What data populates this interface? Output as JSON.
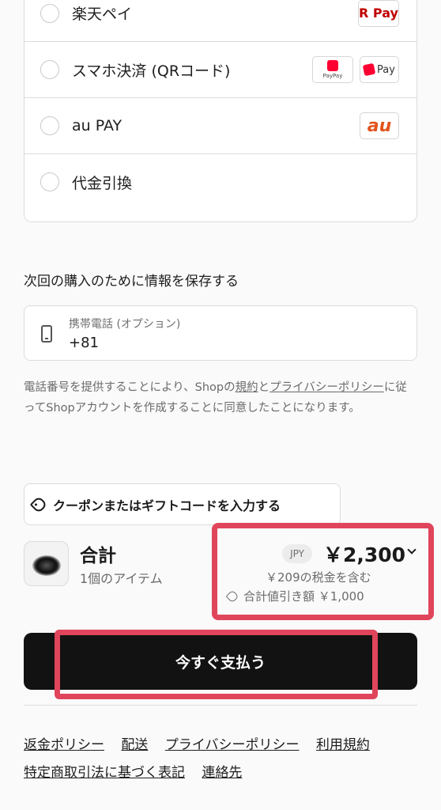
{
  "payment_methods": [
    {
      "label": "楽天ペイ",
      "logos": [
        "R Pay"
      ]
    },
    {
      "label": "スマホ決済 (QRコード)",
      "logos": [
        "PayPay",
        "Pay"
      ]
    },
    {
      "label": "au PAY",
      "logos": [
        "au"
      ]
    },
    {
      "label": "代金引換",
      "logos": []
    }
  ],
  "save_info": {
    "heading": "次回の購入のために情報を保存する",
    "phone_placeholder": "携帯電話 (オプション)",
    "phone_value": "+81",
    "phone_icon": "mobile-phone-icon"
  },
  "consent": {
    "prefix": "電話番号を提供することにより、Shopの",
    "terms_link": "規約",
    "and": "と",
    "privacy_link": "プライバシーポリシー",
    "suffix": "に従ってShopアカウントを作成することに同意したことになります。"
  },
  "coupon": {
    "label": "クーポンまたはギフトコードを入力する",
    "icon": "tag-icon"
  },
  "summary": {
    "title": "合計",
    "items": "1個のアイテム",
    "currency": "JPY",
    "total": "￥2,300",
    "tax": "￥209の税金を含む",
    "discount": "合計値引き額 ￥1,000"
  },
  "pay_button": {
    "label": "今すぐ支払う"
  },
  "footer": {
    "links": [
      "返金ポリシー",
      "配送",
      "プライバシーポリシー",
      "利用規約",
      "特定商取引法に基づく表記",
      "連絡先"
    ]
  },
  "colors": {
    "highlight": "#e0455b",
    "button_bg": "#121212",
    "rakuten_red": "#bf0000",
    "au_orange": "#e2541e"
  }
}
